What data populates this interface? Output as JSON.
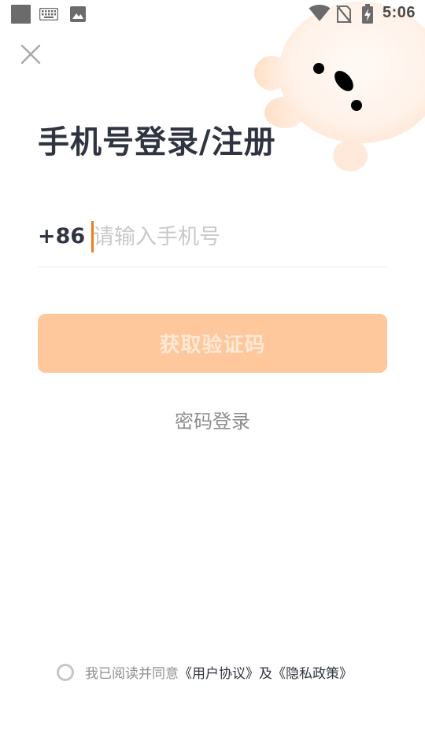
{
  "status_bar": {
    "time": "5:06",
    "icons": [
      "app-icon",
      "keyboard-icon",
      "image-icon",
      "wifi-icon",
      "no-sim-icon",
      "battery-charging-icon"
    ]
  },
  "header": {
    "close_icon": "close-icon",
    "title": "手机号登录/注册"
  },
  "phone": {
    "country_code": "+86",
    "placeholder": "请输入手机号",
    "value": ""
  },
  "actions": {
    "get_code_label": "获取验证码",
    "password_login_label": "密码登录"
  },
  "agreement": {
    "prefix": "我已阅读并同意",
    "user_agreement": "《用户协议》",
    "and": "及",
    "privacy_policy": "《隐私政策》",
    "checked": false
  },
  "colors": {
    "accent": "#f07a1c",
    "button_disabled_bg": "#fec79c",
    "title_text": "#2f3440",
    "placeholder": "#c9c9c9"
  }
}
